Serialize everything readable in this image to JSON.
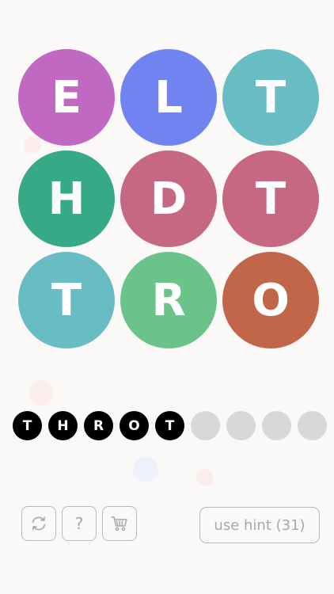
{
  "board": {
    "tiles": [
      {
        "letter": "E",
        "color": "#c068c2"
      },
      {
        "letter": "L",
        "color": "#7183f0"
      },
      {
        "letter": "T",
        "color": "#68bcc3"
      },
      {
        "letter": "H",
        "color": "#36aa87"
      },
      {
        "letter": "D",
        "color": "#c66883"
      },
      {
        "letter": "T",
        "color": "#c66883"
      },
      {
        "letter": "T",
        "color": "#68bcc3"
      },
      {
        "letter": "R",
        "color": "#6ac48a"
      },
      {
        "letter": "O",
        "color": "#c2664a"
      }
    ]
  },
  "answer": {
    "slots": [
      "T",
      "H",
      "R",
      "O",
      "T",
      "",
      "",
      "",
      ""
    ],
    "filled_color": "#000000",
    "empty_color": "#d9d8d6"
  },
  "toolbar": {
    "refresh_icon": "refresh-icon",
    "help_label": "?",
    "cart_icon": "cart-icon"
  },
  "hint": {
    "label": "use hint (31)"
  }
}
